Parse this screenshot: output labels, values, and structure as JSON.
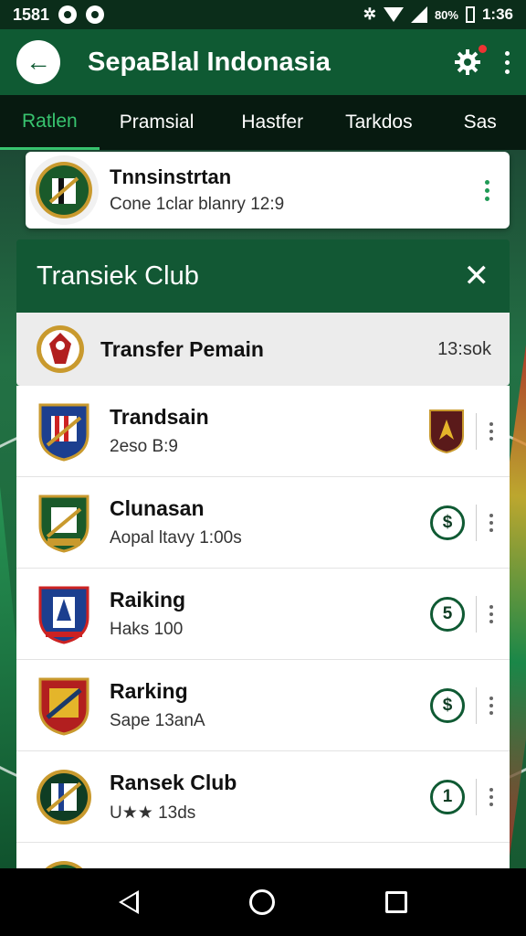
{
  "status_bar": {
    "left_text": "1581",
    "time": "1:36",
    "battery": "80%"
  },
  "app_bar": {
    "title": "SepaBlal Indonasia"
  },
  "tabs": [
    {
      "label": "Ratlen",
      "active": true
    },
    {
      "label": "Pramsial",
      "active": false
    },
    {
      "label": "Hastfer",
      "active": false
    },
    {
      "label": "Tarkdos",
      "active": false
    },
    {
      "label": "Sas",
      "active": false
    }
  ],
  "news_card": {
    "title": "Tnnsinstrtan",
    "subtitle": "Cone 1clar blanry 12:9"
  },
  "dialog": {
    "title": "Transiek Club",
    "subheader": {
      "title": "Transfer Pemain",
      "meta": "13:sok"
    },
    "rows": [
      {
        "name": "Trandsain",
        "meta": "2eso B:9",
        "action": "badge",
        "crest_color": "#1c3f8f"
      },
      {
        "name": "Clunasan",
        "meta": "Aopal ltavy 1:00s",
        "action": "$",
        "crest_color": "#1a5a2a"
      },
      {
        "name": "Raiking",
        "meta": "Haks 100",
        "action": "5",
        "crest_color": "#1c3f8f"
      },
      {
        "name": "Rarking",
        "meta": "Sape 13anA",
        "action": "$",
        "crest_color": "#b21f1f"
      },
      {
        "name": "Ransek Club",
        "meta": "U★★ 13ds",
        "action": "1",
        "crest_color": "#0f3d24"
      }
    ]
  },
  "colors": {
    "primary": "#0f5a33",
    "accent": "#38c46f"
  }
}
